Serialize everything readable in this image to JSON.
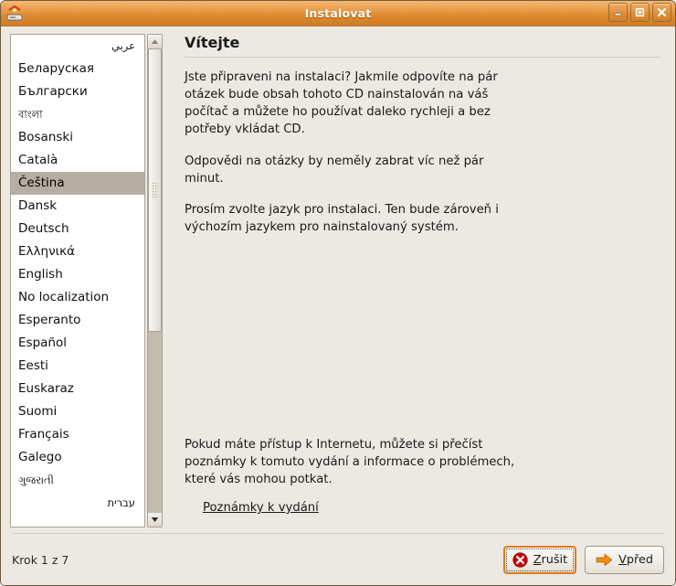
{
  "window": {
    "title": "Instalovat",
    "icon": "cd-drive-icon",
    "controls": [
      {
        "name": "minimize-button",
        "glyph": "minimize-icon"
      },
      {
        "name": "maximize-button",
        "glyph": "maximize-icon"
      },
      {
        "name": "close-button",
        "glyph": "close-icon"
      }
    ]
  },
  "language_list": {
    "selected": "Čeština",
    "items": [
      {
        "label": "عربي",
        "dir": "rtl",
        "size": "small"
      },
      {
        "label": "Беларуская",
        "dir": "ltr",
        "size": "normal"
      },
      {
        "label": "Български",
        "dir": "ltr",
        "size": "normal"
      },
      {
        "label": "বাংলা",
        "dir": "ltr",
        "size": "small"
      },
      {
        "label": "Bosanski",
        "dir": "ltr",
        "size": "normal"
      },
      {
        "label": "Català",
        "dir": "ltr",
        "size": "normal"
      },
      {
        "label": "Čeština",
        "dir": "ltr",
        "size": "normal"
      },
      {
        "label": "Dansk",
        "dir": "ltr",
        "size": "normal"
      },
      {
        "label": "Deutsch",
        "dir": "ltr",
        "size": "normal"
      },
      {
        "label": "Ελληνικά",
        "dir": "ltr",
        "size": "normal"
      },
      {
        "label": "English",
        "dir": "ltr",
        "size": "normal"
      },
      {
        "label": "No localization",
        "dir": "ltr",
        "size": "normal"
      },
      {
        "label": "Esperanto",
        "dir": "ltr",
        "size": "normal"
      },
      {
        "label": "Español",
        "dir": "ltr",
        "size": "normal"
      },
      {
        "label": "Eesti",
        "dir": "ltr",
        "size": "normal"
      },
      {
        "label": "Euskaraz",
        "dir": "ltr",
        "size": "normal"
      },
      {
        "label": "Suomi",
        "dir": "ltr",
        "size": "normal"
      },
      {
        "label": "Français",
        "dir": "ltr",
        "size": "normal"
      },
      {
        "label": "Galego",
        "dir": "ltr",
        "size": "normal"
      },
      {
        "label": "ગુજરાતી",
        "dir": "ltr",
        "size": "small"
      },
      {
        "label": "עברית",
        "dir": "rtl",
        "size": "small"
      }
    ]
  },
  "scrollbar": {
    "up_arrow": "scroll-up-icon",
    "down_arrow": "scroll-down-icon",
    "thumb_fraction": 0.61
  },
  "pane": {
    "title": "Vítejte",
    "paragraph1": "Jste připraveni na instalaci? Jakmile odpovíte na pár otázek bude obsah tohoto CD nainstalován na váš počítač a můžete ho používat daleko rychleji a bez potřeby vkládat CD.",
    "paragraph2": "Odpovědi na otázky by neměly zabrat víc než pár minut.",
    "paragraph3": "Prosím zvolte jazyk pro instalaci. Ten bude zároveň i výchozím jazykem pro nainstalovaný systém.",
    "paragraph4": "Pokud máte přístup k Internetu, můžete si přečíst poznámky k tomuto vydání a informace o problémech, které vás mohou potkat.",
    "release_notes_link": "Poznámky k vydání"
  },
  "footer": {
    "step_text": "Krok 1 z 7",
    "cancel_button": {
      "label": "Zrušit",
      "mnemonic": "Z",
      "icon": "cancel-error-icon",
      "focused": true
    },
    "forward_button": {
      "label": "Vpřed",
      "mnemonic": "V",
      "icon": "forward-arrow-icon",
      "focused": false
    }
  },
  "colors": {
    "titlebar_accent": "#dc8a32",
    "selection": "#b6aea2",
    "window_bg": "#ece9e2",
    "cancel_icon_red": "#cc0000",
    "forward_icon_orange": "#f5900e"
  }
}
